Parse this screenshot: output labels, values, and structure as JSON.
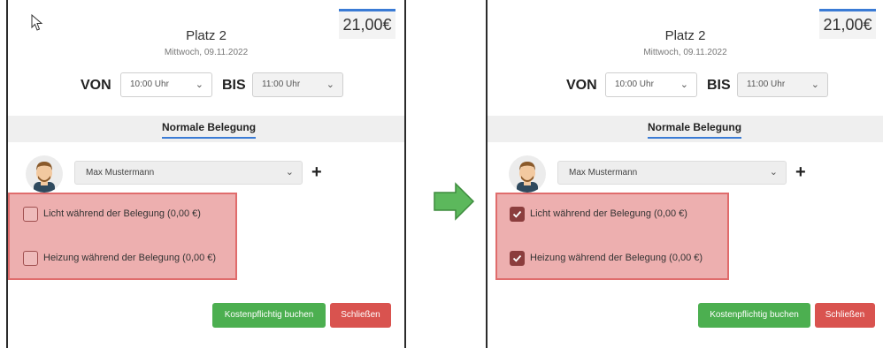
{
  "left_dialog": {
    "price": "21,00€",
    "title": "Platz 2",
    "date": "Mittwoch, 09.11.2022",
    "von_label": "VON",
    "von_value": "10:00 Uhr",
    "bis_label": "BIS",
    "bis_value": "11:00 Uhr",
    "tab": "Normale Belegung",
    "person": "Max Mustermann",
    "add_symbol": "+",
    "checkbox_light_label": "Licht während der Belegung (0,00 €)",
    "checkbox_light_checked": false,
    "checkbox_heating_label": "Heizung während der Belegung (0,00 €)",
    "checkbox_heating_checked": false,
    "book_button": "Kostenpflichtig buchen",
    "close_button": "Schließen"
  },
  "right_dialog": {
    "price": "21,00€",
    "title": "Platz 2",
    "date": "Mittwoch, 09.11.2022",
    "von_label": "VON",
    "von_value": "10:00 Uhr",
    "bis_label": "BIS",
    "bis_value": "11:00 Uhr",
    "tab": "Normale Belegung",
    "person": "Max Mustermann",
    "add_symbol": "+",
    "checkbox_light_label": "Licht während der Belegung (0,00 €)",
    "checkbox_light_checked": true,
    "checkbox_heating_label": "Heizung während der Belegung (0,00 €)",
    "checkbox_heating_checked": true,
    "book_button": "Kostenpflichtig buchen",
    "close_button": "Schließen"
  },
  "icons": {
    "transition": "arrow-right-icon",
    "chevron": "chevron-down-icon",
    "check": "check-icon",
    "avatar": "avatar-icon",
    "cursor": "cursor-icon"
  },
  "colors": {
    "highlight": "#e06c6c",
    "book": "#4caf50",
    "close": "#d9534f",
    "tab_underline": "#3a7bd5",
    "arrow": "#5cb85c"
  }
}
